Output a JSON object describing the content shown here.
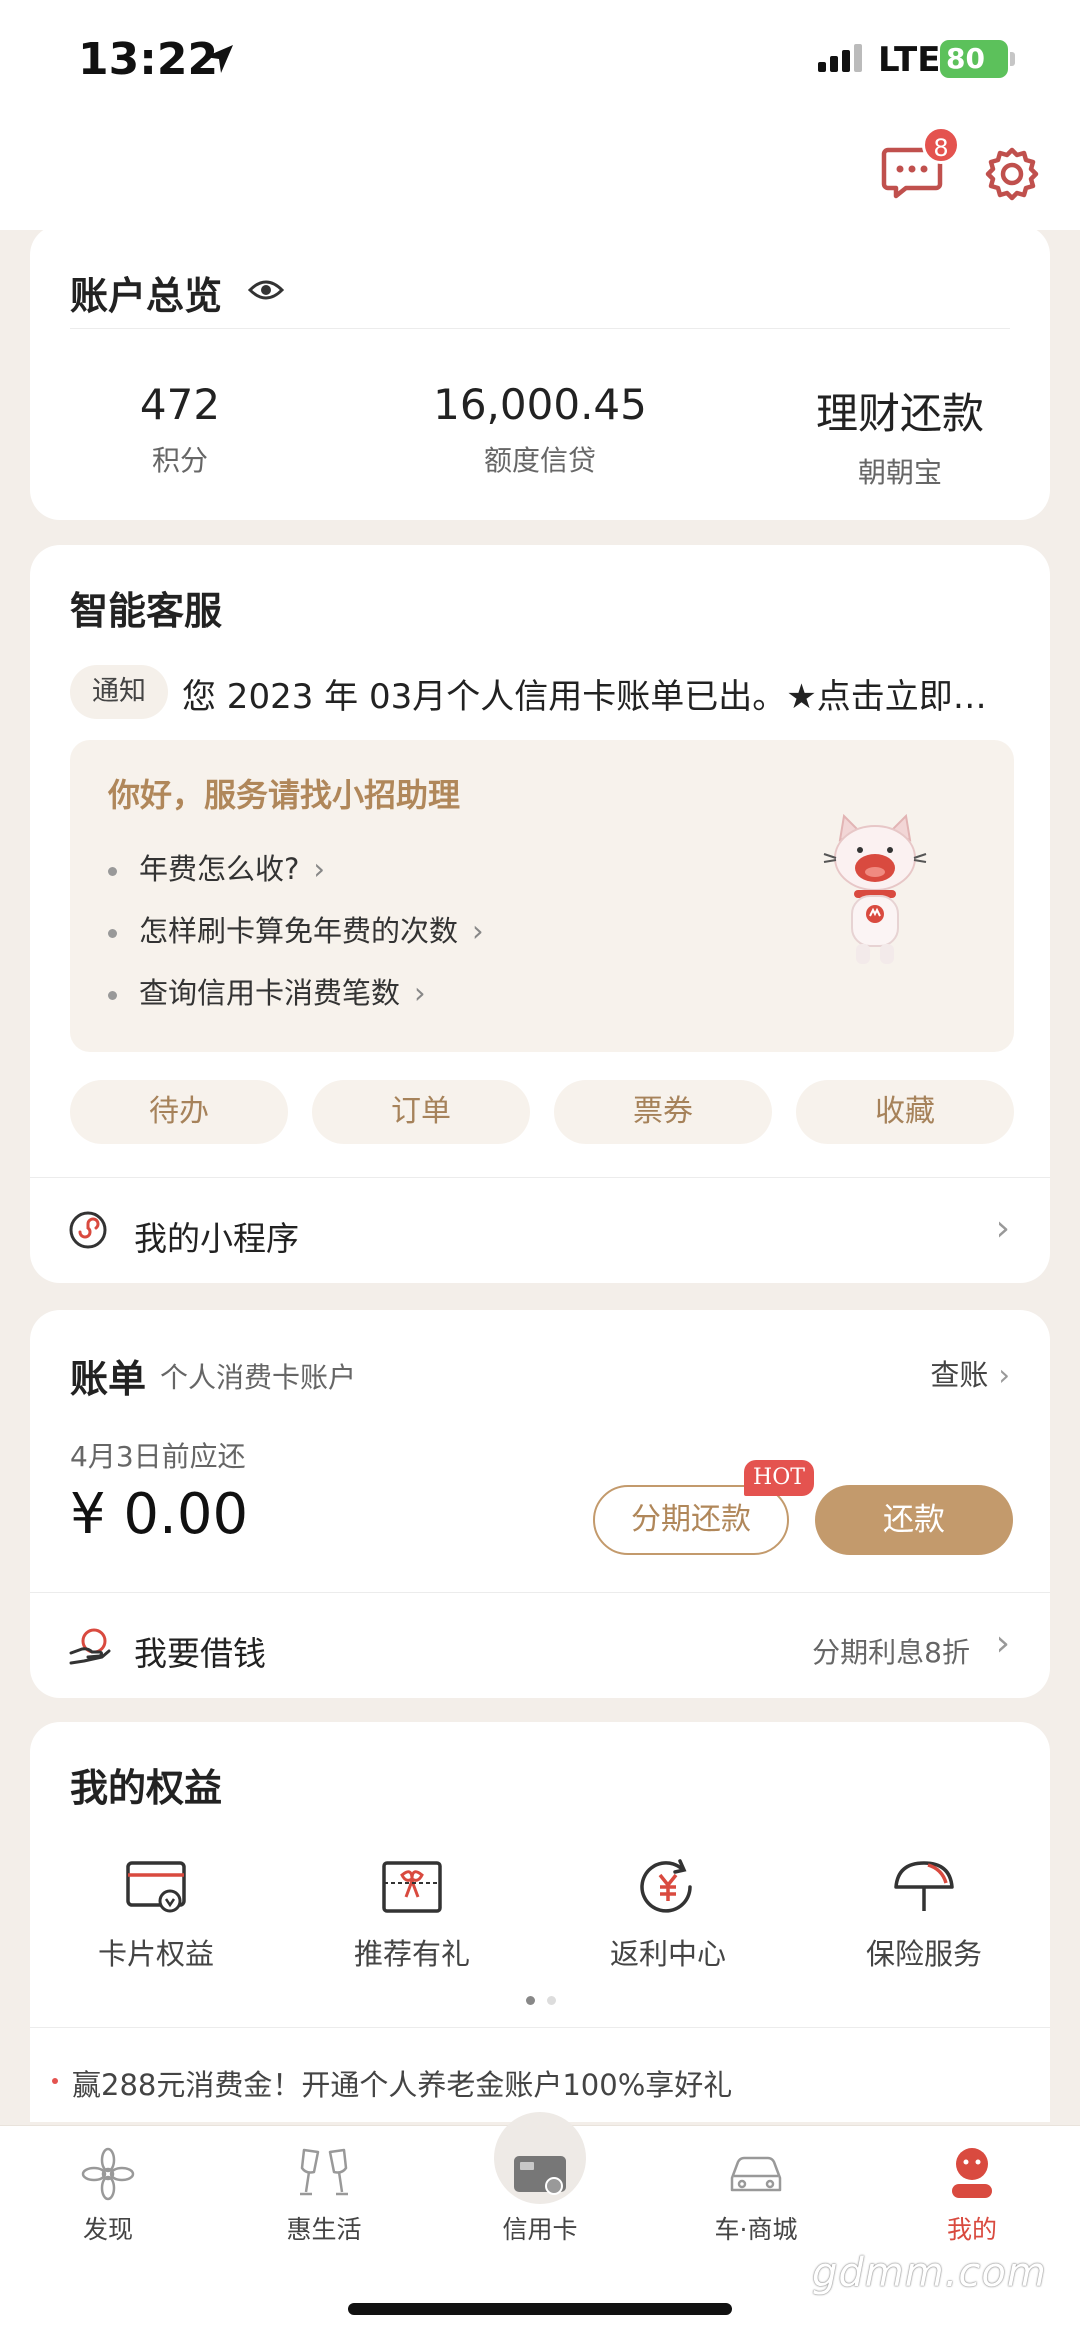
{
  "status_bar": {
    "time": "13:22",
    "network": "LTE",
    "battery": "80"
  },
  "header": {
    "message_badge": "8"
  },
  "account_overview": {
    "title": "账户总览",
    "stats": [
      {
        "value": "472",
        "label": "积分"
      },
      {
        "value": "16,000.45",
        "label": "额度信贷"
      },
      {
        "value": "理财还款",
        "label": "朝朝宝"
      }
    ]
  },
  "smart_service": {
    "title": "智能客服",
    "notice_tag": "通知",
    "notice_text": "您 2023 年 03月个人信用卡账单已出。★点击立即…",
    "assistant_title": "你好，服务请找小招助理",
    "questions": [
      "年费怎么收?",
      "怎样刷卡算免年费的次数",
      "查询信用卡消费笔数"
    ],
    "pills": [
      "待办",
      "订单",
      "票券",
      "收藏"
    ],
    "mini_programs": "我的小程序"
  },
  "bill": {
    "title": "账单",
    "subtitle": "个人消费卡账户",
    "check_link": "查账",
    "due_date": "4月3日前应还",
    "amount": "¥ 0.00",
    "installment_button": "分期还款",
    "hot_badge": "HOT",
    "repay_button": "还款",
    "borrow_label": "我要借钱",
    "borrow_note": "分期利息8折"
  },
  "benefits": {
    "title": "我的权益",
    "items": [
      {
        "label": "卡片权益",
        "icon": "card-benefit-icon"
      },
      {
        "label": "推荐有礼",
        "icon": "gift-icon"
      },
      {
        "label": "返利中心",
        "icon": "yen-cycle-icon"
      },
      {
        "label": "保险服务",
        "icon": "umbrella-icon"
      }
    ],
    "promo": "赢288元消费金！开通个人养老金账户100%享好礼"
  },
  "tabbar": [
    {
      "label": "发现",
      "icon": "flower-icon",
      "active": false
    },
    {
      "label": "惠生活",
      "icon": "cheers-icon",
      "active": false
    },
    {
      "label": "信用卡",
      "icon": "credit-card-icon",
      "active": false
    },
    {
      "label": "车·商城",
      "icon": "car-icon",
      "active": false
    },
    {
      "label": "我的",
      "icon": "profile-icon",
      "active": true
    }
  ],
  "watermark": "gdmm.com",
  "colors": {
    "accent": "#c39a6c",
    "accent_text": "#b0875a",
    "badge_red": "#e4534f",
    "background": "#f3eee9"
  }
}
